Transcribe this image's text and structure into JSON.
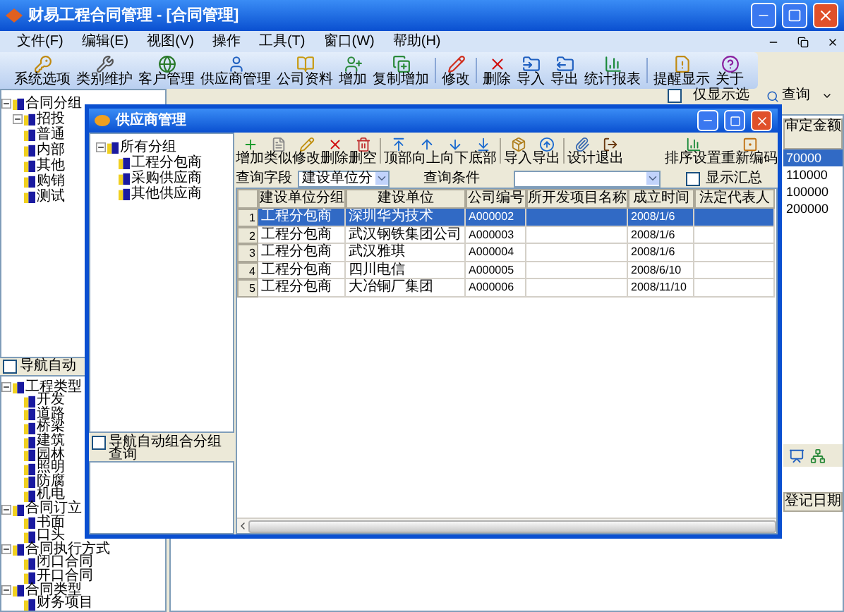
{
  "window": {
    "title": "财易工程合同管理 - [合同管理]"
  },
  "menu": [
    {
      "label": "文件(F)"
    },
    {
      "label": "编辑(E)"
    },
    {
      "label": "视图(V)"
    },
    {
      "label": "操作"
    },
    {
      "label": "工具(T)"
    },
    {
      "label": "窗口(W)"
    },
    {
      "label": "帮助(H)"
    }
  ],
  "toolbar": [
    {
      "label": "系统选项"
    },
    {
      "label": "类别维护"
    },
    {
      "label": "客户管理"
    },
    {
      "label": "供应商管理"
    },
    {
      "label": "公司资料"
    },
    {
      "label": "增加"
    },
    {
      "label": "复制增加"
    },
    {
      "label": "修改"
    },
    {
      "label": "删除"
    },
    {
      "label": "导入"
    },
    {
      "label": "导出"
    },
    {
      "label": "统计报表"
    },
    {
      "label": "提醒显示"
    },
    {
      "label": "关于"
    }
  ],
  "left_panel": {
    "top_tree": [
      {
        "label": "合同分组",
        "expanded": true,
        "children": [
          {
            "label": "招投",
            "expanded": true
          },
          {
            "label": "普通"
          },
          {
            "label": "内部"
          },
          {
            "label": "其他"
          },
          {
            "label": "购销"
          },
          {
            "label": "测试"
          }
        ]
      }
    ],
    "auto_group": {
      "label": "导航自动",
      "checked": false
    },
    "bottom_tree": [
      {
        "label": "工程类型",
        "expanded": true,
        "children": [
          {
            "label": "开发"
          },
          {
            "label": "道路"
          },
          {
            "label": "桥梁"
          },
          {
            "label": "建筑"
          },
          {
            "label": "园林"
          },
          {
            "label": "照明"
          },
          {
            "label": "防腐"
          },
          {
            "label": "机电"
          }
        ]
      },
      {
        "label": "合同订立",
        "expanded": true,
        "children": [
          {
            "label": "书面"
          },
          {
            "label": "口头"
          }
        ]
      },
      {
        "label": "合同执行方式",
        "expanded": true,
        "children": [
          {
            "label": "闭口合同"
          },
          {
            "label": "开口合同"
          }
        ]
      },
      {
        "label": "合同类型",
        "expanded": true,
        "children": [
          {
            "label": "财务项目"
          }
        ]
      }
    ]
  },
  "main_view": {
    "filter": {
      "label": "仅显示选",
      "checked": false
    },
    "query_button": "查询",
    "column_header": "审定金额",
    "amounts": [
      {
        "value": "70000",
        "selected": true
      },
      {
        "value": "110000",
        "selected": false
      },
      {
        "value": "100000",
        "selected": false
      },
      {
        "value": "200000",
        "selected": false
      }
    ],
    "date_header": "登记日期"
  },
  "dialog": {
    "title": "供应商管理",
    "tree": [
      {
        "label": "所有分组",
        "expanded": true,
        "children": [
          {
            "label": "工程分包商"
          },
          {
            "label": "采购供应商"
          },
          {
            "label": "其他供应商"
          }
        ]
      }
    ],
    "auto_group": {
      "label": "导航自动组合分组",
      "checked": false
    },
    "query_note": "查询",
    "toolbar": [
      {
        "label": "增加"
      },
      {
        "label": "类似"
      },
      {
        "label": "修改"
      },
      {
        "label": "删除"
      },
      {
        "label": "删空"
      },
      {
        "label": "顶部"
      },
      {
        "label": "向上"
      },
      {
        "label": "向下"
      },
      {
        "label": "底部"
      },
      {
        "label": "导入"
      },
      {
        "label": "导出"
      },
      {
        "label": "设计"
      },
      {
        "label": "退出"
      },
      {
        "label": "排序设置"
      },
      {
        "label": "重新编码"
      }
    ],
    "query_field_label": "查询字段",
    "query_field_value": "建设单位分",
    "query_condition_label": "查询条件",
    "show_total": {
      "label": "显示汇总",
      "checked": false
    },
    "table": {
      "columns": [
        "建设单位分组",
        "建设单位",
        "公司编号",
        "所开发项目名称",
        "成立时间",
        "法定代表人"
      ],
      "rows": [
        {
          "number": "1",
          "selected": true,
          "cells": [
            "工程分包商",
            "深圳华为技术",
            "A000002",
            "",
            "2008/1/6",
            ""
          ]
        },
        {
          "number": "2",
          "selected": false,
          "cells": [
            "工程分包商",
            "武汉钢铁集团公司",
            "A000003",
            "",
            "2008/1/6",
            ""
          ]
        },
        {
          "number": "3",
          "selected": false,
          "cells": [
            "工程分包商",
            "武汉雅琪",
            "A000004",
            "",
            "2008/1/6",
            ""
          ]
        },
        {
          "number": "4",
          "selected": false,
          "cells": [
            "工程分包商",
            "四川电信",
            "A000005",
            "",
            "2008/6/10",
            ""
          ]
        },
        {
          "number": "5",
          "selected": false,
          "cells": [
            "工程分包商",
            "大冶铜厂集团",
            "A000006",
            "",
            "2008/11/10",
            ""
          ]
        }
      ]
    }
  }
}
